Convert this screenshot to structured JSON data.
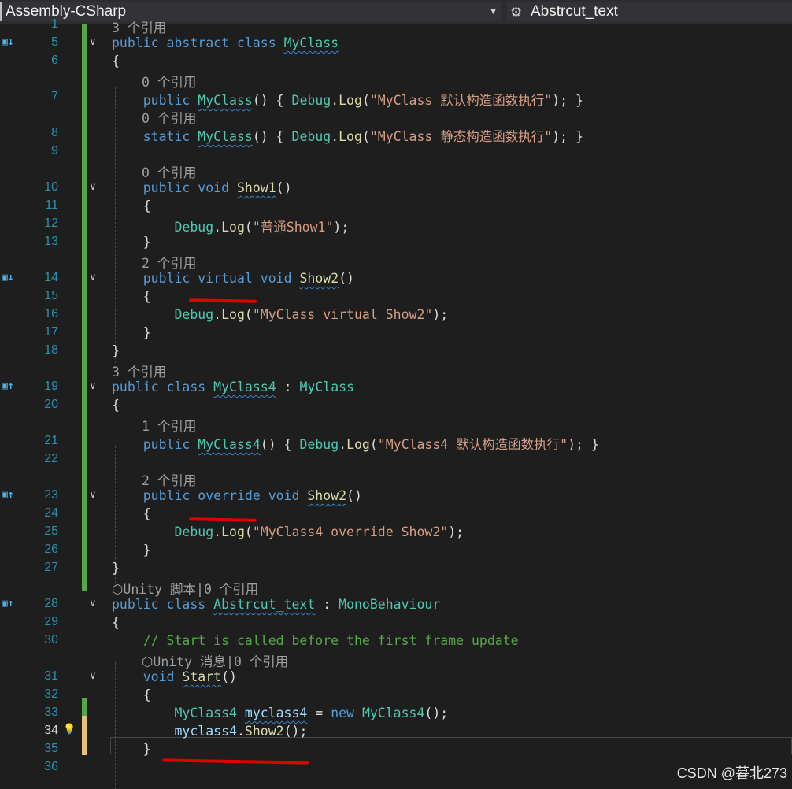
{
  "toolbar": {
    "project_dropdown": "Assembly-CSharp",
    "member_dropdown": "Abstrcut_text"
  },
  "lines": [
    {
      "n": "1",
      "lens": "3 个引用",
      "code": []
    },
    {
      "n": "5",
      "code": [
        [
          "kw",
          "public "
        ],
        [
          "kw",
          "abstract "
        ],
        [
          "kw",
          "class "
        ],
        [
          "ty sq",
          "MyClass"
        ]
      ]
    },
    {
      "n": "6",
      "code": [
        [
          "pl",
          "{"
        ]
      ]
    },
    {
      "n": "",
      "lens": "0 个引用",
      "code": []
    },
    {
      "n": "7",
      "code": [
        [
          "pl",
          "    "
        ],
        [
          "kw",
          "public "
        ],
        [
          "ty sq",
          "MyClass"
        ],
        [
          "pl",
          "() { "
        ],
        [
          "ty",
          "Debug"
        ],
        [
          "pl",
          "."
        ],
        [
          "fn",
          "Log"
        ],
        [
          "pl",
          "("
        ],
        [
          "st",
          "\"MyClass 默认构造函数执行\""
        ],
        [
          "pl",
          "); }"
        ]
      ]
    },
    {
      "n": "",
      "lens": "0 个引用",
      "code": []
    },
    {
      "n": "8",
      "code": [
        [
          "pl",
          "    "
        ],
        [
          "kw",
          "static "
        ],
        [
          "ty sq",
          "MyClass"
        ],
        [
          "pl",
          "() { "
        ],
        [
          "ty",
          "Debug"
        ],
        [
          "pl",
          "."
        ],
        [
          "fn",
          "Log"
        ],
        [
          "pl",
          "("
        ],
        [
          "st",
          "\"MyClass 静态构造函数执行\""
        ],
        [
          "pl",
          "); }"
        ]
      ]
    },
    {
      "n": "9",
      "code": []
    },
    {
      "n": "",
      "lens": "0 个引用",
      "code": []
    },
    {
      "n": "10",
      "code": [
        [
          "pl",
          "    "
        ],
        [
          "kw",
          "public "
        ],
        [
          "kw",
          "void "
        ],
        [
          "fn sq",
          "Show1"
        ],
        [
          "pl",
          "()"
        ]
      ]
    },
    {
      "n": "11",
      "code": [
        [
          "pl",
          "    {"
        ]
      ]
    },
    {
      "n": "12",
      "code": [
        [
          "pl",
          "        "
        ],
        [
          "ty",
          "Debug"
        ],
        [
          "pl",
          "."
        ],
        [
          "fn",
          "Log"
        ],
        [
          "pl",
          "("
        ],
        [
          "st",
          "\"普通Show1\""
        ],
        [
          "pl",
          ");"
        ]
      ]
    },
    {
      "n": "13",
      "code": [
        [
          "pl",
          "    }"
        ]
      ]
    },
    {
      "n": "",
      "lens": "2 个引用",
      "code": []
    },
    {
      "n": "14",
      "code": [
        [
          "pl",
          "    "
        ],
        [
          "kw",
          "public "
        ],
        [
          "kw",
          "virtual "
        ],
        [
          "kw",
          "void "
        ],
        [
          "fn sq",
          "Show2"
        ],
        [
          "pl",
          "()"
        ]
      ]
    },
    {
      "n": "15",
      "code": [
        [
          "pl",
          "    {"
        ]
      ]
    },
    {
      "n": "16",
      "code": [
        [
          "pl",
          "        "
        ],
        [
          "ty",
          "Debug"
        ],
        [
          "pl",
          "."
        ],
        [
          "fn",
          "Log"
        ],
        [
          "pl",
          "("
        ],
        [
          "st",
          "\"MyClass virtual Show2\""
        ],
        [
          "pl",
          ");"
        ]
      ]
    },
    {
      "n": "17",
      "code": [
        [
          "pl",
          "    }"
        ]
      ]
    },
    {
      "n": "18",
      "code": [
        [
          "pl",
          "}"
        ]
      ]
    },
    {
      "n": "",
      "lens": "3 个引用",
      "code": []
    },
    {
      "n": "19",
      "code": [
        [
          "kw",
          "public "
        ],
        [
          "kw",
          "class "
        ],
        [
          "ty sq",
          "MyClass4"
        ],
        [
          "pl",
          " : "
        ],
        [
          "ty",
          "MyClass"
        ]
      ]
    },
    {
      "n": "20",
      "code": [
        [
          "pl",
          "{"
        ]
      ]
    },
    {
      "n": "",
      "lens": "1 个引用",
      "code": []
    },
    {
      "n": "21",
      "code": [
        [
          "pl",
          "    "
        ],
        [
          "kw",
          "public "
        ],
        [
          "ty sq",
          "MyClass4"
        ],
        [
          "pl",
          "() { "
        ],
        [
          "ty",
          "Debug"
        ],
        [
          "pl",
          "."
        ],
        [
          "fn",
          "Log"
        ],
        [
          "pl",
          "("
        ],
        [
          "st",
          "\"MyClass4 默认构造函数执行\""
        ],
        [
          "pl",
          "); }"
        ]
      ]
    },
    {
      "n": "22",
      "code": []
    },
    {
      "n": "",
      "lens": "2 个引用",
      "code": []
    },
    {
      "n": "23",
      "code": [
        [
          "pl",
          "    "
        ],
        [
          "kw",
          "public "
        ],
        [
          "kw",
          "override "
        ],
        [
          "kw",
          "void "
        ],
        [
          "fn sq",
          "Show2"
        ],
        [
          "pl",
          "()"
        ]
      ]
    },
    {
      "n": "24",
      "code": [
        [
          "pl",
          "    {"
        ]
      ]
    },
    {
      "n": "25",
      "code": [
        [
          "pl",
          "        "
        ],
        [
          "ty",
          "Debug"
        ],
        [
          "pl",
          "."
        ],
        [
          "fn",
          "Log"
        ],
        [
          "pl",
          "("
        ],
        [
          "st",
          "\"MyClass4 override Show2\""
        ],
        [
          "pl",
          ");"
        ]
      ]
    },
    {
      "n": "26",
      "code": [
        [
          "pl",
          "    }"
        ]
      ]
    },
    {
      "n": "27",
      "code": [
        [
          "pl",
          "}"
        ]
      ]
    },
    {
      "n": "",
      "lens": "⬡Unity 脚本|0 个引用",
      "code": []
    },
    {
      "n": "28",
      "code": [
        [
          "kw",
          "public "
        ],
        [
          "kw",
          "class "
        ],
        [
          "ty sq",
          "Abstrcut_text"
        ],
        [
          "pl",
          " : "
        ],
        [
          "ty",
          "MonoBehaviour"
        ]
      ]
    },
    {
      "n": "29",
      "code": [
        [
          "pl",
          "{"
        ]
      ]
    },
    {
      "n": "30",
      "code": [
        [
          "pl",
          "    "
        ],
        [
          "cm",
          "// Start is called before the first frame update"
        ]
      ]
    },
    {
      "n": "",
      "lens": "⬡Unity 消息|0 个引用",
      "code": []
    },
    {
      "n": "31",
      "code": [
        [
          "pl",
          "    "
        ],
        [
          "kw",
          "void "
        ],
        [
          "fn sq",
          "Start"
        ],
        [
          "pl",
          "()"
        ]
      ]
    },
    {
      "n": "32",
      "code": [
        [
          "pl",
          "    {"
        ]
      ]
    },
    {
      "n": "33",
      "code": [
        [
          "pl",
          "        "
        ],
        [
          "ty",
          "MyClass4 "
        ],
        [
          "vr sq",
          "myclass4"
        ],
        [
          "pl",
          " = "
        ],
        [
          "kw",
          "new "
        ],
        [
          "ty",
          "MyClass4"
        ],
        [
          "pl",
          "();"
        ]
      ]
    },
    {
      "n": "34",
      "code": [
        [
          "pl",
          "        "
        ],
        [
          "vr",
          "myclass4"
        ],
        [
          "pl",
          "."
        ],
        [
          "fn",
          "Show2"
        ],
        [
          "pl",
          "();"
        ]
      ]
    },
    {
      "n": "35",
      "code": [
        [
          "pl",
          "    }"
        ]
      ]
    },
    {
      "n": "36",
      "code": []
    }
  ],
  "watermark": "CSDN @暮北273"
}
